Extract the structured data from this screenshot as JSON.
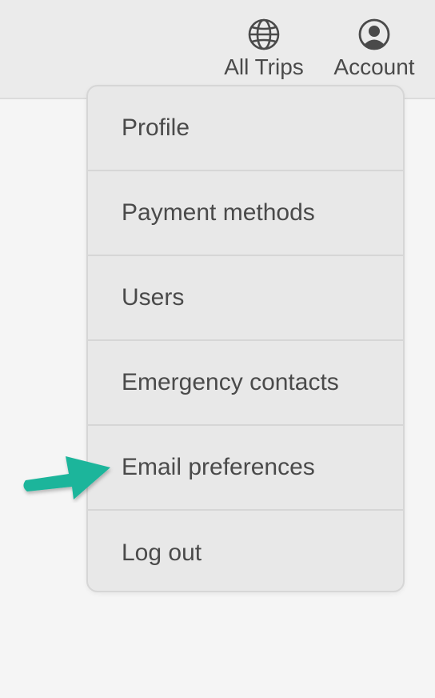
{
  "header": {
    "nav": [
      {
        "label": "All Trips",
        "icon": "globe-icon"
      },
      {
        "label": "Account",
        "icon": "account-circle-icon"
      }
    ]
  },
  "account_menu": {
    "items": [
      {
        "label": "Profile"
      },
      {
        "label": "Payment methods"
      },
      {
        "label": "Users"
      },
      {
        "label": "Emergency contacts"
      },
      {
        "label": "Email preferences"
      },
      {
        "label": "Log out"
      }
    ]
  },
  "colors": {
    "background": "#f5f5f5",
    "header_background": "#ebebeb",
    "menu_background": "#e8e8e8",
    "text": "#4a4a4a",
    "arrow": "#1fb59b"
  },
  "annotation": {
    "icon": "arrow-right-icon",
    "points_to": "Email preferences"
  }
}
